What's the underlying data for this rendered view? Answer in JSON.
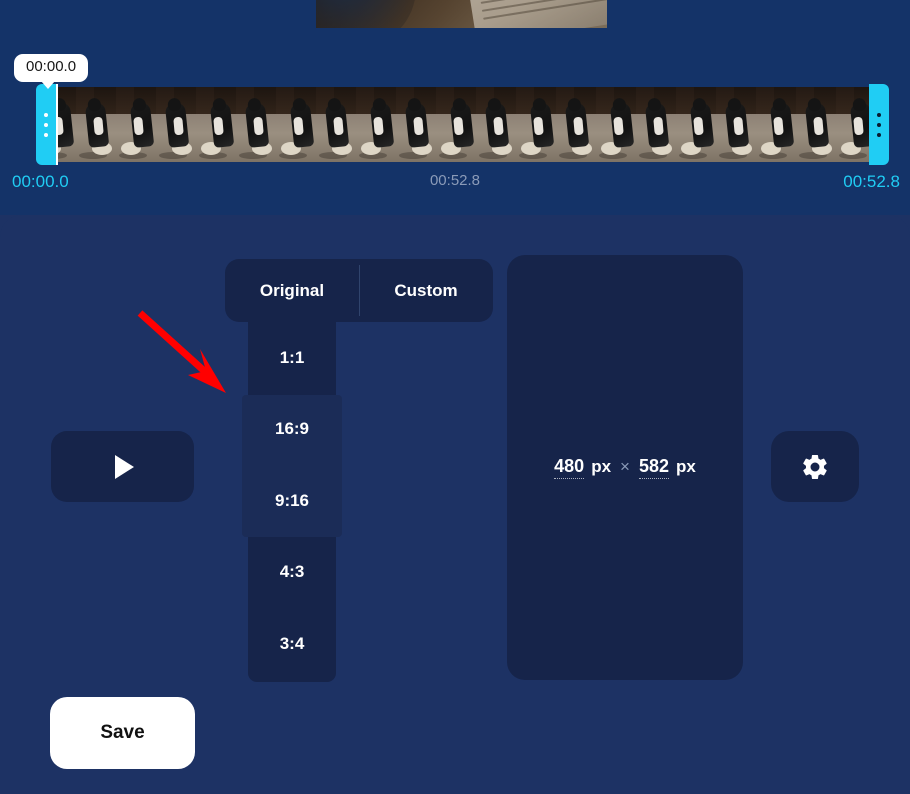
{
  "app": {
    "name": "video-editor-crop-panel"
  },
  "timeline": {
    "tooltip_time": "00:00.0",
    "start_label": "00:00.0",
    "duration_label": "00:52.8",
    "end_label": "00:52.8",
    "frame_count": 21,
    "left_handle_icon": "drag-handle-icon",
    "right_handle_icon": "drag-handle-icon",
    "playhead_icon": "playhead-marker"
  },
  "controls": {
    "play_icon": "play-icon",
    "settings_icon": "gear-icon",
    "save_label": "Save"
  },
  "tabs": [
    {
      "label": "Original",
      "selected": true
    },
    {
      "label": "Custom",
      "selected": false
    }
  ],
  "ratios": [
    {
      "label": "1:1"
    },
    {
      "label": "16:9"
    },
    {
      "label": "9:16"
    },
    {
      "label": "4:3"
    },
    {
      "label": "3:4"
    }
  ],
  "size": {
    "width_value": "480",
    "width_unit": "px",
    "separator": "×",
    "height_value": "582",
    "height_unit": "px"
  },
  "annotation": {
    "type": "red-arrow",
    "color": "#ff0000",
    "points_to": "ratio-list"
  },
  "colors": {
    "page_background": "#1d3264",
    "timeline_background": "#143368",
    "panel": "#16244a",
    "panel_highlight": "#1b2c57",
    "accent_cyan": "#20cdf4",
    "muted_text": "#8b9bb8",
    "save_button": "#ffffff"
  }
}
